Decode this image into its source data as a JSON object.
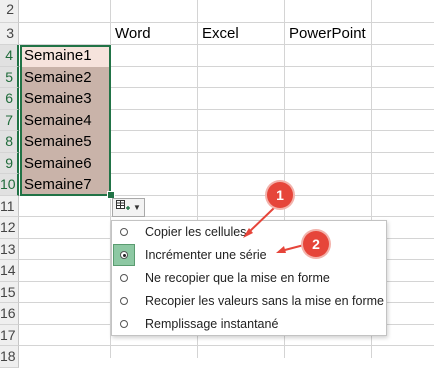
{
  "rows": [
    "2",
    "3",
    "4",
    "5",
    "6",
    "7",
    "8",
    "9",
    "10",
    "11",
    "12",
    "13",
    "14",
    "15",
    "16",
    "17",
    "18"
  ],
  "selected_rows": [
    "4",
    "5",
    "6",
    "7",
    "8",
    "9",
    "10"
  ],
  "header_row": {
    "b": "Word",
    "c": "Excel",
    "d": "PowerPoint"
  },
  "series": [
    "Semaine1",
    "Semaine2",
    "Semaine3",
    "Semaine4",
    "Semaine5",
    "Semaine6",
    "Semaine7"
  ],
  "autofill_menu": {
    "items": [
      {
        "label": "Copier les cellules",
        "checked": false
      },
      {
        "label": "Incrémenter une série",
        "checked": true
      },
      {
        "label": "Ne recopier que la mise en forme",
        "checked": false
      },
      {
        "label": "Recopier les valeurs sans la mise en forme",
        "checked": false
      },
      {
        "label": "Remplissage instantané",
        "checked": false
      }
    ]
  },
  "callouts": [
    "1",
    "2"
  ],
  "colors": {
    "accent": "#217346",
    "callout": "#e6453a",
    "selection": "#c9b3a9"
  }
}
